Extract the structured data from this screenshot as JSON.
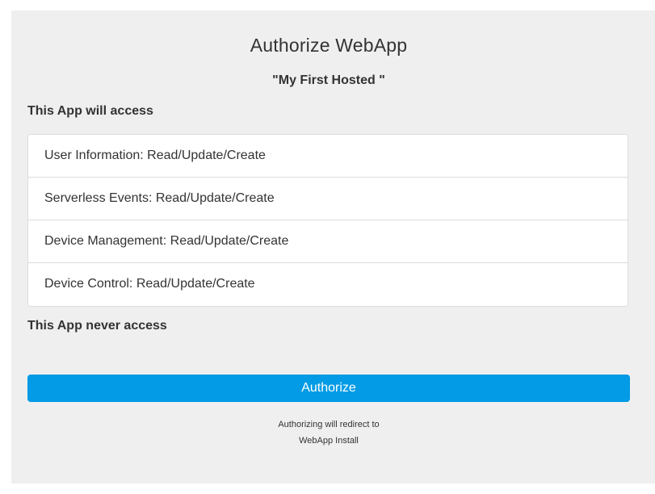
{
  "header": {
    "title": "Authorize WebApp",
    "app_name": "\"My First Hosted \""
  },
  "access": {
    "heading": "This App will access",
    "permissions": [
      "User Information: Read/Update/Create",
      "Serverless Events: Read/Update/Create",
      "Device Management: Read/Update/Create",
      "Device Control: Read/Update/Create"
    ]
  },
  "never_access": {
    "heading": "This App never access"
  },
  "actions": {
    "authorize_label": "Authorize"
  },
  "redirect": {
    "line1": "Authorizing will redirect to",
    "line2": "WebApp Install"
  },
  "colors": {
    "panel_background": "#efefef",
    "button_background": "#039be5"
  }
}
